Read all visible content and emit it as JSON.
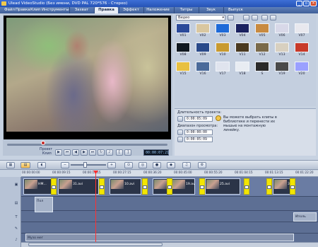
{
  "window": {
    "title": "Ulead VideoStudio (Без имени, DVD PAL 720*576 - Стерео)"
  },
  "menu": [
    "Файл",
    "Правка",
    "Клип",
    "Инструменты"
  ],
  "steps": {
    "capture": "Захват",
    "edit": "Правка",
    "effect": "Эффект",
    "overlay": "Наложение",
    "title": "Титры",
    "audio": "Звук",
    "share": "Выпуск"
  },
  "player": {
    "mode_project": "Проект",
    "mode_clip": "Клип",
    "timecode": "00:00:07:21"
  },
  "library": {
    "category": "Видео",
    "thumbs": [
      {
        "label": "V01",
        "color": "#2b4a9a"
      },
      {
        "label": "V02",
        "color": "#d9c7a0"
      },
      {
        "label": "V03",
        "color": "#1e6ad8"
      },
      {
        "label": "V04",
        "color": "#1a2260"
      },
      {
        "label": "V05",
        "color": "#c88a40"
      },
      {
        "label": "V06",
        "color": "#d8d8e8"
      },
      {
        "label": "V07",
        "color": "#e8e8ee"
      },
      {
        "label": "V08",
        "color": "#101820"
      },
      {
        "label": "V09",
        "color": "#2a4a8a"
      },
      {
        "label": "V10",
        "color": "#c89a30"
      },
      {
        "label": "V11",
        "color": "#4a3a20"
      },
      {
        "label": "V12",
        "color": "#7a6a4a"
      },
      {
        "label": "V13",
        "color": "#d8d0c0"
      },
      {
        "label": "V14",
        "color": "#c83a2a"
      },
      {
        "label": "V15",
        "color": "#e8c040"
      },
      {
        "label": "V16",
        "color": "#4a6a9a"
      },
      {
        "label": "V17",
        "color": "#e0e4ee"
      },
      {
        "label": "V18",
        "color": "#e8ecf2"
      },
      {
        "label": "S",
        "color": "#2a2a2a"
      },
      {
        "label": "V19",
        "color": "#4a4a4a"
      },
      {
        "label": "V20",
        "color": "#9aa0ff"
      }
    ]
  },
  "options": {
    "duration_label": "Длительность проекта:",
    "duration_value": "0:00:05:09",
    "range_label": "Диапазон просмотра:",
    "range_start": "0:00:00:00",
    "range_end": "0:00:05:09",
    "hint": "Вы можете выбрать клипы в библиотеке и перенести их мышью на монтажную линейку."
  },
  "ruler": [
    "00:00:00:00",
    "00:00:09:15",
    "00:00:19:15",
    "00:00:27:15",
    "00:00:36:20",
    "00:00:45:00",
    "00:00:55:20",
    "00:01:04:15",
    "00:01:13:15",
    "00:01:22:20"
  ],
  "clips": [
    {
      "label": "НМ..."
    },
    {
      "label": "31.avi"
    },
    {
      "label": "10.avi"
    },
    {
      "label": "20.avi"
    },
    {
      "label": "19.avi"
    },
    {
      "label": "25.avi"
    },
    {
      "label": "30.avi"
    }
  ],
  "overlays": {
    "left": "Пол",
    "right": "Иполь",
    "music": "Музо мег"
  },
  "track_icons": [
    "video-track-icon",
    "overlay-track-icon",
    "title-track-icon",
    "voice-track-icon",
    "music-track-icon"
  ]
}
